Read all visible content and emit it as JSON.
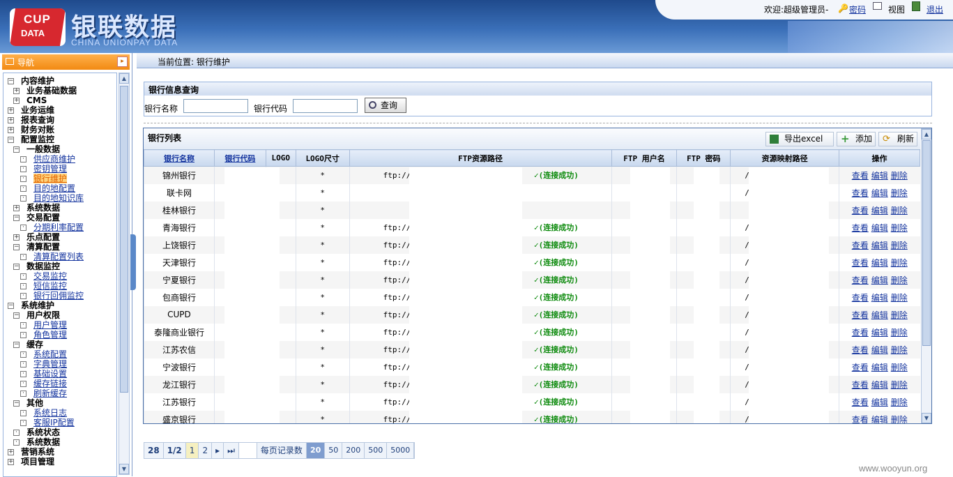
{
  "header": {
    "cup": "CUP",
    "data": "DATA",
    "brand": "银联数据",
    "brand_en": "CHINA UNIONPAY DATA",
    "welcome": "欢迎:超级管理员-",
    "password": "密码",
    "view": "视图",
    "logout": "退出"
  },
  "breadcrumb": "当前位置: 银行维护",
  "nav": {
    "title": "导航",
    "items": [
      {
        "label": "内容维护",
        "level": 0,
        "box": "−"
      },
      {
        "label": "业务基础数据",
        "level": 1,
        "box": "+"
      },
      {
        "label": "CMS",
        "level": 1,
        "box": "+"
      },
      {
        "label": "业务运维",
        "level": 0,
        "box": "+"
      },
      {
        "label": "报表查询",
        "level": 0,
        "box": "+"
      },
      {
        "label": "财务对账",
        "level": 0,
        "box": "+"
      },
      {
        "label": "配置监控",
        "level": 0,
        "box": "−"
      },
      {
        "label": "一般数据",
        "level": 1,
        "box": "−"
      },
      {
        "label": "供应商维护",
        "level": 2,
        "box": "·"
      },
      {
        "label": "密钥管理",
        "level": 2,
        "box": "·"
      },
      {
        "label": "银行维护",
        "level": 2,
        "box": "·",
        "selected": true
      },
      {
        "label": "目的地配置",
        "level": 2,
        "box": "·"
      },
      {
        "label": "目的地知识库",
        "level": 2,
        "box": "·"
      },
      {
        "label": "系统数据",
        "level": 1,
        "box": "+"
      },
      {
        "label": "交易配置",
        "level": 1,
        "box": "−"
      },
      {
        "label": "分期利率配置",
        "level": 2,
        "box": "·"
      },
      {
        "label": "乐点配置",
        "level": 1,
        "box": "+"
      },
      {
        "label": "清算配置",
        "level": 1,
        "box": "−"
      },
      {
        "label": "清算配置列表",
        "level": 2,
        "box": "·"
      },
      {
        "label": "数据监控",
        "level": 1,
        "box": "−"
      },
      {
        "label": "交易监控",
        "level": 2,
        "box": "·"
      },
      {
        "label": "短信监控",
        "level": 2,
        "box": "·"
      },
      {
        "label": "银行回佣监控",
        "level": 2,
        "box": "·"
      },
      {
        "label": "系统维护",
        "level": 0,
        "box": "−"
      },
      {
        "label": "用户权限",
        "level": 1,
        "box": "−"
      },
      {
        "label": "用户管理",
        "level": 2,
        "box": "·"
      },
      {
        "label": "角色管理",
        "level": 2,
        "box": "·"
      },
      {
        "label": "缓存",
        "level": 1,
        "box": "−"
      },
      {
        "label": "系统配置",
        "level": 2,
        "box": "·"
      },
      {
        "label": "字典管理",
        "level": 2,
        "box": "·"
      },
      {
        "label": "基础设置",
        "level": 2,
        "box": "·"
      },
      {
        "label": "缓存链接",
        "level": 2,
        "box": "·"
      },
      {
        "label": "刷新缓存",
        "level": 2,
        "box": "·"
      },
      {
        "label": "其他",
        "level": 1,
        "box": "−"
      },
      {
        "label": "系统日志",
        "level": 2,
        "box": "·"
      },
      {
        "label": "客服IP配置",
        "level": 2,
        "box": "·"
      },
      {
        "label": "系统状态",
        "level": 1,
        "box": "·"
      },
      {
        "label": "系统数据",
        "level": 1,
        "box": "·"
      },
      {
        "label": "营销系统",
        "level": 0,
        "box": "+"
      },
      {
        "label": "项目管理",
        "level": 0,
        "box": "+"
      }
    ]
  },
  "query": {
    "title": "银行信息查询",
    "bank_name_label": "银行名称",
    "bank_code_label": "银行代码",
    "bank_name_value": "",
    "bank_code_value": "",
    "search_button": "查询"
  },
  "list": {
    "title": "银行列表",
    "export": "导出excel",
    "add": "添加",
    "refresh": "刷新",
    "columns": [
      "银行名称",
      "银行代码",
      "LOGO",
      "LOGO尺寸",
      "FTP资源路径",
      "FTP 用户名",
      "FTP 密码",
      "资源映射路径",
      "操作"
    ],
    "rows": [
      {
        "name": "锦州银行",
        "size": "*",
        "ftp": "ftp://1",
        "status": "✓(连接成功)",
        "map": "/"
      },
      {
        "name": "联卡网",
        "size": "*",
        "ftp": "",
        "status": "",
        "map": "/"
      },
      {
        "name": "桂林银行",
        "size": "*",
        "ftp": "",
        "status": "",
        "map": ""
      },
      {
        "name": "青海银行",
        "size": "*",
        "ftp": "ftp://1",
        "status": "✓(连接成功)",
        "map": "/"
      },
      {
        "name": "上饶银行",
        "size": "*",
        "ftp": "ftp://1",
        "status": "✓(连接成功)",
        "map": "/"
      },
      {
        "name": "天津银行",
        "size": "*",
        "ftp": "ftp://1",
        "status": "✓(连接成功)",
        "map": "/"
      },
      {
        "name": "宁夏银行",
        "size": "*",
        "ftp": "ftp://1",
        "status": "✓(连接成功)",
        "map": "/"
      },
      {
        "name": "包商银行",
        "size": "*",
        "ftp": "ftp://1",
        "status": "✓(连接成功)",
        "map": "/"
      },
      {
        "name": "CUPD",
        "size": "*",
        "ftp": "ftp://1",
        "status": "✓(连接成功)",
        "map": "/"
      },
      {
        "name": "泰隆商业银行",
        "size": "*",
        "ftp": "ftp://1",
        "status": "✓(连接成功)",
        "map": "/"
      },
      {
        "name": "江苏农信",
        "size": "*",
        "ftp": "ftp://1",
        "status": "✓(连接成功)",
        "map": "/"
      },
      {
        "name": "宁波银行",
        "size": "*",
        "ftp": "ftp://1",
        "status": "✓(连接成功)",
        "map": "/"
      },
      {
        "name": "龙江银行",
        "size": "*",
        "ftp": "ftp://1",
        "status": "✓(连接成功)",
        "map": "/"
      },
      {
        "name": "江苏银行",
        "size": "*",
        "ftp": "ftp://1",
        "status": "✓(连接成功)",
        "map": "/"
      },
      {
        "name": "盛京银行",
        "size": "*",
        "ftp": "ftp://1",
        "status": "✓(连接成功)",
        "map": "/"
      }
    ],
    "ops": {
      "view": "查看",
      "edit": "编辑",
      "delete": "删除"
    }
  },
  "pager": {
    "total": "28",
    "pages": "1/2",
    "p1": "1",
    "p2": "2",
    "next": "▸",
    "last": "⏭",
    "per_page_label": "每页记录数",
    "sizes": [
      "20",
      "50",
      "200",
      "500",
      "5000"
    ],
    "selected_size": "20"
  },
  "watermark": "www.wooyun.org"
}
